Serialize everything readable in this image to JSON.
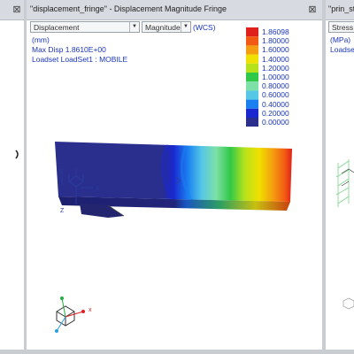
{
  "main": {
    "title": "\"displacement_fringe\" - Displacement Magnitude Fringe",
    "quantity": "Displacement",
    "component": "Magnitude",
    "csys": "(WCS)",
    "unit": "(mm)",
    "max_disp": "Max Disp  1.8610E+00",
    "loadset": "Loadset LoadSet1 :  MOBILE",
    "legend": {
      "values": [
        "1.86098",
        "1.80000",
        "1.60000",
        "1.40000",
        "1.20000",
        "1.00000",
        "0.80000",
        "0.60000",
        "0.40000",
        "0.20000",
        "0.00000"
      ],
      "colors": [
        "#e0201a",
        "#f25a14",
        "#f49d10",
        "#f0e000",
        "#b6e21c",
        "#30c848",
        "#7de0a6",
        "#56c8e6",
        "#1a7ff0",
        "#1a28d0",
        "#2a2e8c"
      ]
    },
    "triad_label": "x"
  },
  "right": {
    "title": "\"prin_str",
    "quantity": "Stress",
    "unit": "(MPa)",
    "loadset": "Loadse"
  },
  "colors": {
    "panel_bg": "#ffffff",
    "chrome": "#d7dae0",
    "text_blue": "#1a36b8",
    "beam_base": "#2a2e8c"
  }
}
